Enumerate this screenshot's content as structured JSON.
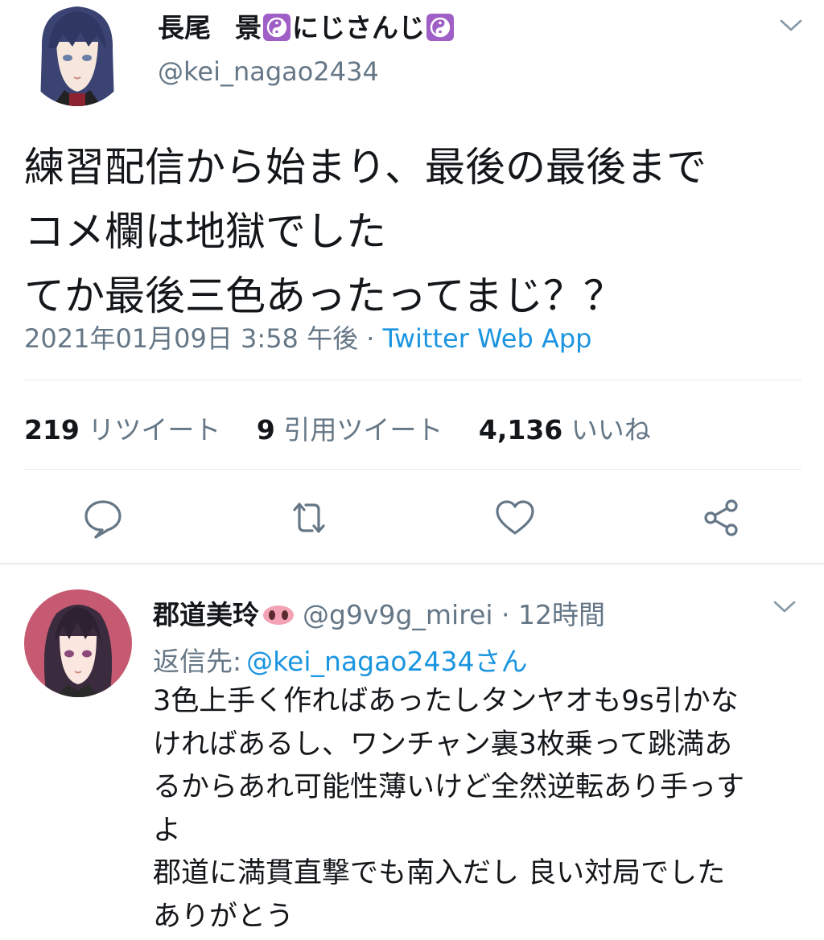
{
  "tweet": {
    "author": {
      "display_name_part1": "長尾",
      "display_name_part2": "景",
      "display_name_part3": "にじさんじ",
      "handle": "@kei_nagao2434",
      "emoji_icon": "yin-yang-icon"
    },
    "text_lines": [
      "練習配信から始まり、最後の最後まで",
      "コメ欄は地獄でした",
      "てか最後三色あったってまじ？？"
    ],
    "timestamp": "2021年01月09日 3:58 午後",
    "separator": " · ",
    "source": "Twitter Web App",
    "stats": {
      "retweets": "219",
      "retweets_label": "リツイート",
      "quotes": "9",
      "quotes_label": "引用ツイート",
      "likes": "4,136",
      "likes_label": "いいね"
    },
    "actions": [
      "reply-icon",
      "retweet-icon",
      "like-icon",
      "share-icon"
    ]
  },
  "reply": {
    "author": {
      "display_name": "郡道美玲",
      "handle": "@g9v9g_mirei",
      "time": " · 12時間",
      "emoji_icon": "pig-nose-icon"
    },
    "replying_to_label": "返信先:",
    "replying_to_mention": "@kei_nagao2434さん",
    "text_lines": [
      "3色上手く作ればあったしタンヤオも9s引かな",
      "ければあるし、ワンチャン裏3枚乗って跳満あ",
      "るからあれ可能性薄いけど全然逆転あり手っす",
      "よ",
      "郡道に満貫直撃でも南入だし 良い対局でした",
      "ありがとう"
    ]
  },
  "colors": {
    "text": "#14171a",
    "secondary": "#657786",
    "link": "#1b95e0",
    "divider": "#e1e8ed",
    "emoji_purple": "#a05ec7"
  }
}
